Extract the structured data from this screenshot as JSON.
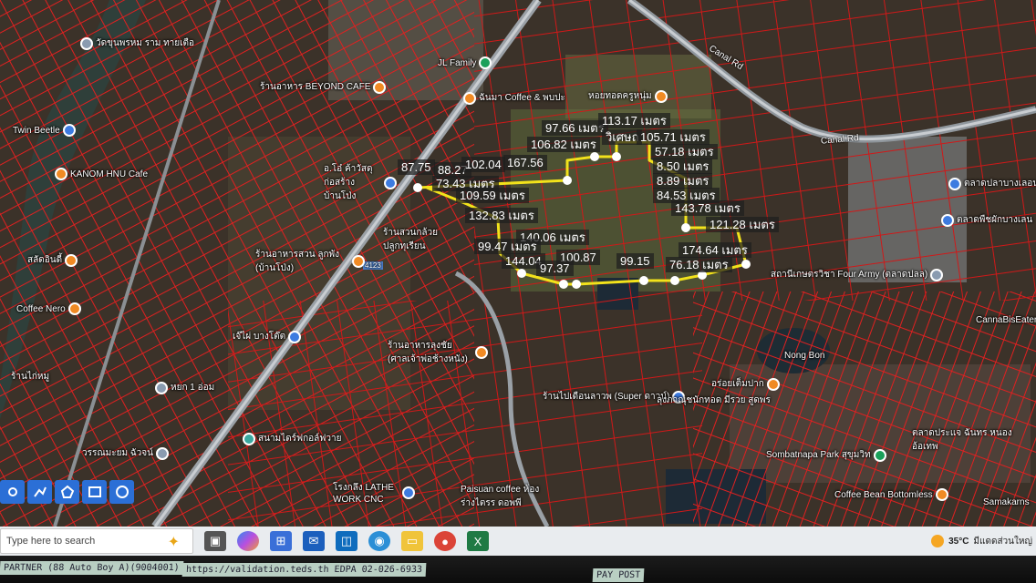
{
  "poi": [
    {
      "id": "wat-khun",
      "label": "วัดขุนพรหม ราม ทายเตือ",
      "color": "gray"
    },
    {
      "id": "jl-family",
      "label": "JL Family",
      "color": "green"
    },
    {
      "id": "beyond",
      "label": "ร้านอาหาร BEYOND CAFE",
      "color": "orange"
    },
    {
      "id": "coffee-pp",
      "label": "ฉันมา Coffee & พบปะ",
      "color": "orange"
    },
    {
      "id": "hoi-thot",
      "label": "หอยทอดครูหนุ่ม",
      "color": "orange"
    },
    {
      "id": "twin-beetle",
      "label": "Twin Beetle",
      "color": "blue"
    },
    {
      "id": "kanom-hnu",
      "label": "KANOM HNU Cafe",
      "color": "orange"
    },
    {
      "id": "oyoo",
      "label": "อ.โอ๋ ค้าวัสดุ ก่อสร้าง บ้านโป่ง",
      "color": "blue"
    },
    {
      "id": "satit",
      "label": "สลัดอินดี้",
      "color": "orange"
    },
    {
      "id": "coffee-nero",
      "label": "Coffee Nero",
      "color": "orange"
    },
    {
      "id": "suan-aharn",
      "label": "ร้านอาหารสวน ลูกพัง (บ้านโป่ง)",
      "color": "orange"
    },
    {
      "id": "suan-klai",
      "label": "ร้านสวนกล้วย ปลูกทุเรียน",
      "color": "orange"
    },
    {
      "id": "jeh-phai",
      "label": "เจ๊ไผ่ บางโต๊ต",
      "color": "blue"
    },
    {
      "id": "rong-arharn",
      "label": "ร้านอาหารลุงชัย (ศาลเจ้าพ่อช้างหนัง)",
      "color": "orange"
    },
    {
      "id": "talad-pla",
      "label": "ตลาดปลาบางเลอน และสวนสัตว์",
      "color": "blue"
    },
    {
      "id": "talad-puek",
      "label": "ตลาดพืชผักบางเลน",
      "color": "blue"
    },
    {
      "id": "four-army",
      "label": "สถานีเกษตรวิชา Four Army (ตลาดปลล)",
      "color": "gray"
    },
    {
      "id": "nong-bon",
      "label": "Nong Bon",
      "color": "gray"
    },
    {
      "id": "cannabis",
      "label": "CannaBisEater",
      "color": "green"
    },
    {
      "id": "aroy-tem",
      "label": "อร่อยเต็มปาก",
      "color": "orange"
    },
    {
      "id": "super",
      "label": "ร้านไปเดือนลาวพ (Super ดาวน์)",
      "color": "blue"
    },
    {
      "id": "lung-pa",
      "label": "ลุงภาณุชนักทอด มีรวย สูดพร",
      "color": "orange"
    },
    {
      "id": "sombatnapa",
      "label": "Sombatnapa Park สุขุมวิท",
      "color": "green"
    },
    {
      "id": "sanam",
      "label": "สนามไดร์ฟกอล์ฟวาย",
      "color": "green"
    },
    {
      "id": "lathe",
      "label": "โรงกลึง LATHE WORK CNC",
      "color": "blue"
    },
    {
      "id": "paisan",
      "label": "Paisuan coffee ห้องร่างไตรร ดอพพี",
      "color": "orange"
    },
    {
      "id": "coffee-bean",
      "label": "Coffee Bean Bottomless",
      "color": "orange"
    },
    {
      "id": "samakarn",
      "label": "Samakarns",
      "color": "orange"
    },
    {
      "id": "wanchai",
      "label": "วรรณมะยม ฉัวจน์",
      "color": "gray"
    },
    {
      "id": "hok",
      "label": "หยก 1 อ่อม",
      "color": "gray"
    },
    {
      "id": "talad-prang",
      "label": "ตลาดประแจ ฉันทร หนองอ้อเทพ",
      "color": "orange"
    },
    {
      "id": "khai",
      "label": "ร้านไก่หมู",
      "color": "orange"
    }
  ],
  "roads": {
    "canal_rd_1": "Canal Rd",
    "canal_rd_2": "Canal Rd",
    "r4123": "4123"
  },
  "measurements": [
    "87.75",
    "88.27",
    "102.04",
    "167.56",
    "97.66",
    "113.17",
    "106.82",
    "วิเศษถ",
    "105.71",
    "57.18",
    "73.43",
    "109.59",
    "8.50",
    "8.89",
    "84.53",
    "143.78",
    "132.83",
    "140.06",
    "121.28",
    "99.47",
    "174.64",
    "144.04",
    "100.87",
    "99.15",
    "97.37",
    "76.18"
  ],
  "measurement_unit": "เมตร",
  "taskbar": {
    "search_placeholder": "Type here to search",
    "icons": [
      "widgets-icon",
      "copilot-icon",
      "store-icon",
      "mail-icon",
      "outlook-icon",
      "edge-icon",
      "explorer-icon",
      "chrome-icon",
      "excel-icon"
    ],
    "weather_temp": "35°C",
    "weather_text": "มีแดดส่วนใหญ่"
  },
  "notes": [
    {
      "id": "note-1",
      "text": "PARTNER (88 Auto Boy A)(9004001)"
    },
    {
      "id": "note-2",
      "text": "https://validation.teds.th    EDPA 02-026-6933"
    },
    {
      "id": "note-3",
      "text": "PAY POST"
    }
  ]
}
